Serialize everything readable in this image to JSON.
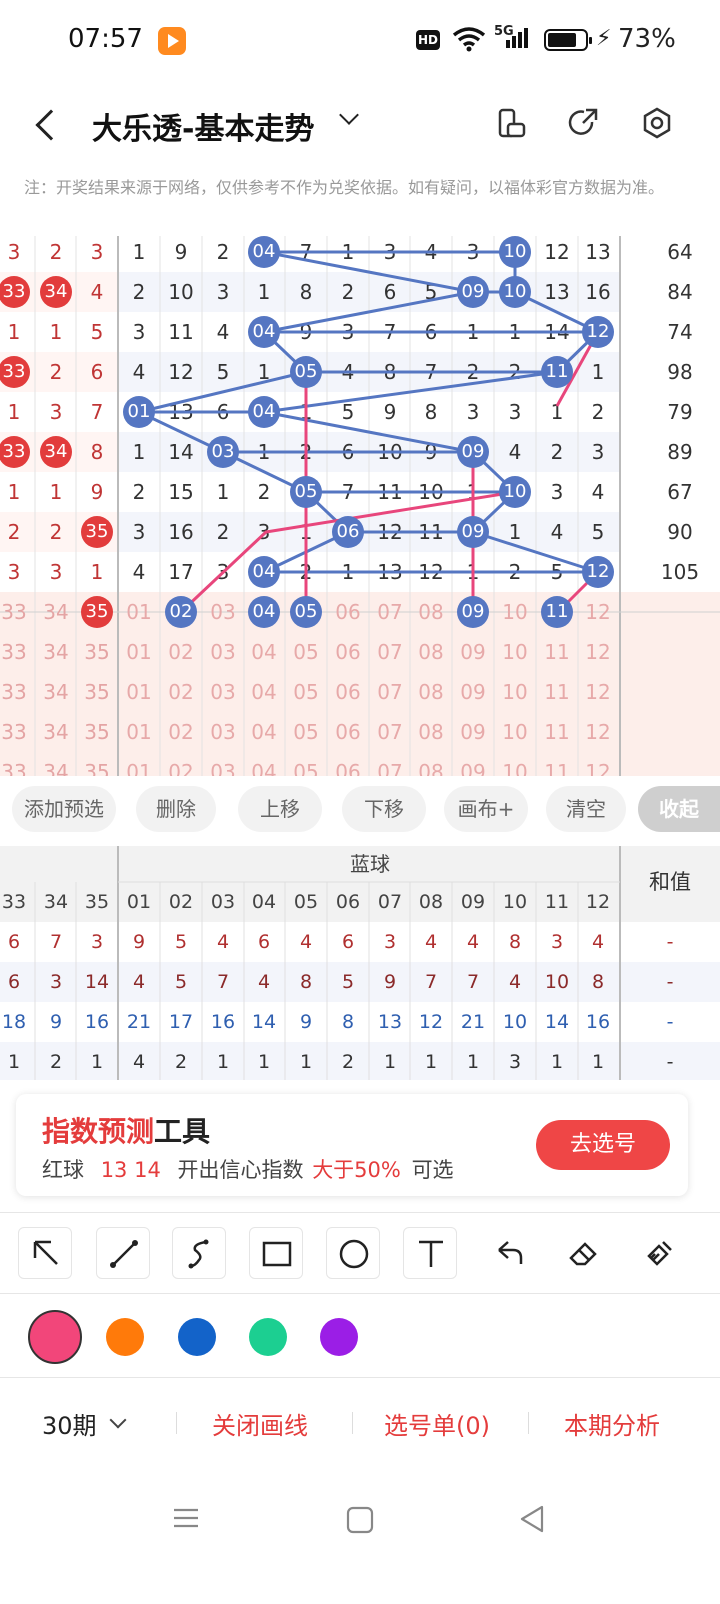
{
  "status": {
    "time": "07:57",
    "hd": "HD",
    "fiveg": "5G",
    "battery": "73%"
  },
  "header": {
    "title": "大乐透-基本走势"
  },
  "notice": "注：开奖结果来源于网络，仅供参考不作为兑奖依据。如有疑问，以福体彩官方数据为准。",
  "grid": {
    "rows": [
      {
        "red": [
          "3",
          "2",
          "3"
        ],
        "blue": [
          "1",
          "9",
          "2",
          "04",
          "7",
          "1",
          "3",
          "4",
          "3",
          "10",
          "12",
          "13"
        ],
        "sum": "64"
      },
      {
        "red": [
          "33",
          "34",
          "4"
        ],
        "blue": [
          "2",
          "10",
          "3",
          "1",
          "8",
          "2",
          "6",
          "5",
          "09",
          "10",
          "13",
          "16"
        ],
        "sum": "84"
      },
      {
        "red": [
          "1",
          "1",
          "5"
        ],
        "blue": [
          "3",
          "11",
          "4",
          "04",
          "9",
          "3",
          "7",
          "6",
          "1",
          "1",
          "14",
          "12"
        ],
        "sum": "74"
      },
      {
        "red": [
          "33",
          "2",
          "6"
        ],
        "blue": [
          "4",
          "12",
          "5",
          "1",
          "05",
          "4",
          "8",
          "7",
          "2",
          "2",
          "11",
          "1"
        ],
        "sum": "98"
      },
      {
        "red": [
          "1",
          "3",
          "7"
        ],
        "blue": [
          "01",
          "13",
          "6",
          "04",
          "1",
          "5",
          "9",
          "8",
          "3",
          "3",
          "1",
          "2"
        ],
        "sum": "79"
      },
      {
        "red": [
          "33",
          "34",
          "8"
        ],
        "blue": [
          "1",
          "14",
          "03",
          "1",
          "2",
          "6",
          "10",
          "9",
          "09",
          "4",
          "2",
          "3"
        ],
        "sum": "89"
      },
      {
        "red": [
          "1",
          "1",
          "9"
        ],
        "blue": [
          "2",
          "15",
          "1",
          "2",
          "05",
          "7",
          "11",
          "10",
          "1",
          "10",
          "3",
          "4"
        ],
        "sum": "67"
      },
      {
        "red": [
          "2",
          "2",
          "35"
        ],
        "blue": [
          "3",
          "16",
          "2",
          "3",
          "1",
          "06",
          "12",
          "11",
          "09",
          "1",
          "4",
          "5"
        ],
        "sum": "90"
      },
      {
        "red": [
          "3",
          "3",
          "1"
        ],
        "blue": [
          "4",
          "17",
          "3",
          "04",
          "2",
          "1",
          "13",
          "12",
          "1",
          "2",
          "5",
          "12"
        ],
        "sum": "105"
      }
    ],
    "pickRows": [
      {
        "red": [
          "33",
          "34",
          "35"
        ],
        "blue": [
          "01",
          "02",
          "03",
          "04",
          "05",
          "06",
          "07",
          "08",
          "09",
          "10",
          "11",
          "12"
        ]
      },
      {
        "red": [
          "33",
          "34",
          "35"
        ],
        "blue": [
          "01",
          "02",
          "03",
          "04",
          "05",
          "06",
          "07",
          "08",
          "09",
          "10",
          "11",
          "12"
        ]
      },
      {
        "red": [
          "33",
          "34",
          "35"
        ],
        "blue": [
          "01",
          "02",
          "03",
          "04",
          "05",
          "06",
          "07",
          "08",
          "09",
          "10",
          "11",
          "12"
        ]
      },
      {
        "red": [
          "33",
          "34",
          "35"
        ],
        "blue": [
          "01",
          "02",
          "03",
          "04",
          "05",
          "06",
          "07",
          "08",
          "09",
          "10",
          "11",
          "12"
        ]
      },
      {
        "red": [
          "33",
          "34",
          "35"
        ],
        "blue": [
          "01",
          "02",
          "03",
          "04",
          "05",
          "06",
          "07",
          "08",
          "09",
          "10",
          "11",
          "12"
        ]
      }
    ]
  },
  "actions": {
    "add": "添加预选",
    "delete": "删除",
    "up": "上移",
    "down": "下移",
    "canvas": "画布+",
    "clear": "清空",
    "collapse": "收起"
  },
  "stats": {
    "section": "蓝球",
    "sumHeader": "和值",
    "redHeaders": [
      "33",
      "34",
      "35"
    ],
    "blueHeaders": [
      "01",
      "02",
      "03",
      "04",
      "05",
      "06",
      "07",
      "08",
      "09",
      "10",
      "11",
      "12"
    ],
    "rows": [
      {
        "red": [
          "6",
          "7",
          "3"
        ],
        "blue": [
          "9",
          "5",
          "4",
          "6",
          "4",
          "6",
          "3",
          "4",
          "4",
          "8",
          "3",
          "4"
        ],
        "sum": "-",
        "color": "#b03030"
      },
      {
        "red": [
          "6",
          "3",
          "14"
        ],
        "blue": [
          "4",
          "5",
          "7",
          "4",
          "8",
          "5",
          "9",
          "7",
          "7",
          "4",
          "10",
          "8"
        ],
        "sum": "-",
        "color": "#8b2a2a"
      },
      {
        "red": [
          "18",
          "9",
          "16"
        ],
        "blue": [
          "21",
          "17",
          "16",
          "14",
          "9",
          "8",
          "13",
          "12",
          "21",
          "10",
          "14",
          "16"
        ],
        "sum": "-",
        "color": "#2f5fb0"
      },
      {
        "red": [
          "1",
          "2",
          "1"
        ],
        "blue": [
          "4",
          "2",
          "1",
          "1",
          "1",
          "2",
          "1",
          "1",
          "1",
          "3",
          "1",
          "1"
        ],
        "sum": "-",
        "color": "#333333"
      }
    ]
  },
  "promo": {
    "title_red": "指数预测",
    "title_black": "工具",
    "desc_prefix": "红球",
    "desc_nums": "13 14",
    "desc_mid": "开出信心指数",
    "desc_highlight": "大于50%",
    "desc_suffix": "可选",
    "button": "去选号"
  },
  "colors": [
    "#f2467a",
    "#ff7a0a",
    "#1363c9",
    "#1ccf91",
    "#9b1ee6"
  ],
  "bottom": {
    "period": "30期",
    "close": "关闭画线",
    "list": "选号单(0)",
    "analysis": "本期分析"
  }
}
